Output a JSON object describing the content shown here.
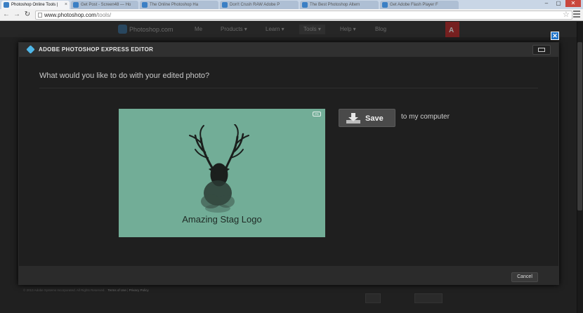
{
  "browser": {
    "tabs": [
      {
        "label": "Photoshop Online Tools |",
        "active": true
      },
      {
        "label": "Get Post - Screen48 — Ho",
        "active": false
      },
      {
        "label": "The Online Photoshop Ha",
        "active": false
      },
      {
        "label": "Don't Crush RAW Adobe P",
        "active": false
      },
      {
        "label": "The Best Photoshop Altern",
        "active": false
      },
      {
        "label": "Get Adobe Flash Player F",
        "active": false
      }
    ],
    "url_host": "www.photoshop.com",
    "url_path": "/tools/",
    "window_controls": {
      "minimize": "–",
      "maximize": "▢",
      "close": "✕"
    }
  },
  "site_nav": {
    "logo_text": "Photoshop.com",
    "items": [
      "Me",
      "Products ▾",
      "Learn ▾",
      "Tools ▾",
      "Help ▾",
      "Blog"
    ]
  },
  "modal": {
    "title": "ADOBE PHOTOSHOP EXPRESS EDITOR",
    "close_glyph": "✕",
    "question": "What would you like to do with your edited photo?",
    "photo": {
      "caption": "Amazing Stag Logo",
      "badge": "PS"
    },
    "save": {
      "label": "Save",
      "suffix": "to my computer"
    },
    "cancel_label": "Cancel"
  },
  "footer": {
    "copyright": "© 2013 Adobe Systems Incorporated. All Rights Reserved.",
    "terms": "Terms of Use",
    "separator": "|",
    "privacy": "Privacy Policy"
  },
  "colors": {
    "photo_bg": "#72ad97",
    "close_blue": "#1e73c8",
    "modal_bg": "#1f1f1f"
  }
}
